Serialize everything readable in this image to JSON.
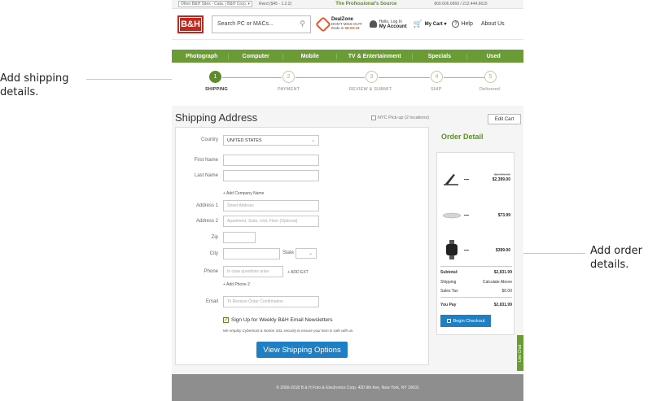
{
  "annotations": {
    "left": "Add shipping details.",
    "right": "Add order details."
  },
  "topbar": {
    "selector": "Other B&H Sites - Cata. | B&H Corp. ▾",
    "rewards": "Rwrd  ($45 · 1.2.2)",
    "tagline": "The Professional's Source",
    "phones": "800.606.6969 / 212.444.6615"
  },
  "header": {
    "logo": "B&H",
    "search_placeholder": "Search PC or MACs...",
    "deal": {
      "title": "DealZone",
      "subtitle": "DON'T MISS OUT!",
      "ends_label": "Ends In",
      "timer": "08:00:23"
    },
    "account": {
      "greeting": "Hello, Log In",
      "label": "My Account"
    },
    "cart": "My Cart ▾",
    "help": "Help",
    "about": "About Us"
  },
  "nav": [
    "Photograph",
    "Computer",
    "Mobile",
    "TV & Entertainment",
    "Specials",
    "Used"
  ],
  "steps": [
    {
      "num": "1",
      "label": "SHIPPING"
    },
    {
      "num": "2",
      "label": "PAYMENT"
    },
    {
      "num": "3",
      "label": "REVIEW & SUBMIT"
    },
    {
      "num": "4",
      "label": "SHIP"
    },
    {
      "num": "5",
      "label": "Delivered"
    }
  ],
  "shipping": {
    "title": "Shipping Address",
    "nyc_pickup": "NYC Pick-up (2 locations)",
    "edit_cart": "Edit Cart",
    "fields": {
      "country_label": "Country",
      "country_value": "UNITED STATES",
      "first_name_label": "First Name",
      "last_name_label": "Last Name",
      "add_company": "+ Add Company Name",
      "address1_label": "Address 1",
      "address1_placeholder": "Street Address",
      "address2_label": "Address 2",
      "address2_placeholder": "Apartment, Suite, Unit, Floor (Optional)",
      "zip_label": "Zip",
      "city_label": "City",
      "state_label": "State",
      "phone_label": "Phone",
      "phone_placeholder": "In case questions arise",
      "add_ext": "+ ADD EXT",
      "add_phone2": "+ Add Phone 2",
      "email_label": "Email",
      "email_placeholder": "To Receive Order Confirmation"
    },
    "newsletter": "Sign Up for Weekly B&H Email Newsletters",
    "secure_note": "We employ Cybertrust & Norton SSL security to ensure your item is safe with us.",
    "submit": "View Shipping Options"
  },
  "order": {
    "title": "Order Detail",
    "items": [
      {
        "old_price": "$2,799.00",
        "price": "$2,399.00"
      },
      {
        "old_price": "",
        "price": "$73.99"
      },
      {
        "old_price": "",
        "price": "$399.00"
      }
    ],
    "summary": {
      "subtotal_label": "Subtotal:",
      "subtotal": "$2,831.99",
      "shipping_label": "Shipping",
      "shipping": "Calculate Above",
      "tax_label": "Sales Tax",
      "tax": "$0.00",
      "total_label": "You Pay",
      "total": "$2,831.99"
    },
    "checkout": "Begin Checkout"
  },
  "livechat": "Live Chat",
  "footer": "© 2000-2018 B & H Foto & Electronics Corp. 420 9th Ave, New York, NY 10001",
  "colors": {
    "brand_red": "#c7251c",
    "green": "#6a9b35",
    "blue": "#1f7fc4"
  }
}
